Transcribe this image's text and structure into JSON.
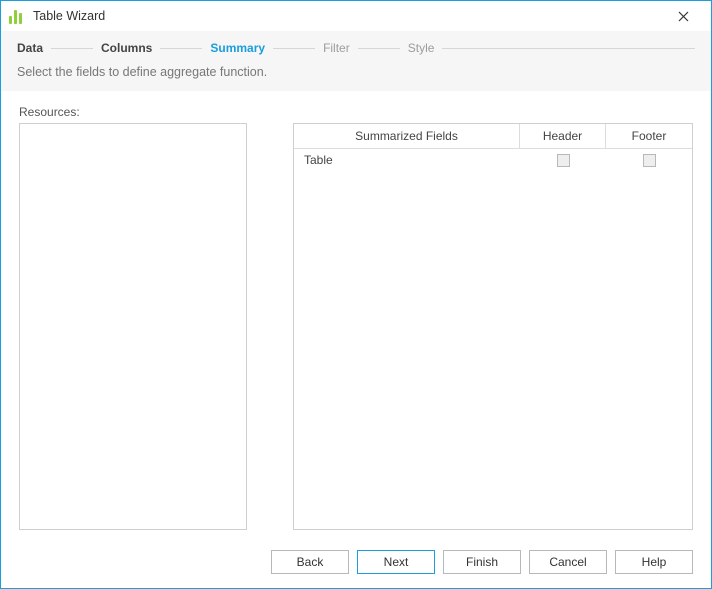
{
  "window": {
    "title": "Table Wizard"
  },
  "steps": {
    "data": "Data",
    "columns": "Columns",
    "summary": "Summary",
    "filter": "Filter",
    "style": "Style"
  },
  "description": "Select the fields to define aggregate function.",
  "resources_label": "Resources:",
  "grid": {
    "columns": {
      "summarized": "Summarized Fields",
      "header": "Header",
      "footer": "Footer"
    },
    "rows": [
      {
        "name": "Table",
        "header_checked": false,
        "footer_checked": false
      }
    ]
  },
  "buttons": {
    "back": "Back",
    "next": "Next",
    "finish": "Finish",
    "cancel": "Cancel",
    "help": "Help"
  }
}
